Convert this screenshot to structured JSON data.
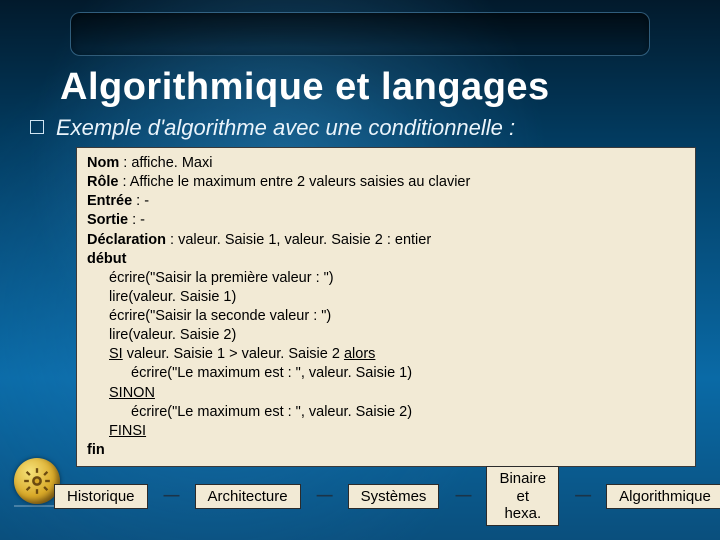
{
  "title": "Algorithmique et langages",
  "subtitle": "Exemple d'algorithme avec une conditionnelle :",
  "algo": {
    "nom_label": "Nom",
    "nom_value": " : affiche. Maxi",
    "role_label": "Rôle",
    "role_value": " : Affiche le maximum entre 2 valeurs saisies au clavier",
    "entree_label": "Entrée",
    "entree_value": " : -",
    "sortie_label": "Sortie",
    "sortie_value": " : -",
    "decl_label": "Déclaration",
    "decl_value": " : valeur. Saisie 1, valeur. Saisie 2 : entier",
    "debut": "début",
    "l1": "écrire(\"Saisir la première valeur : \")",
    "l2": "lire(valeur. Saisie 1)",
    "l3": "écrire(\"Saisir la seconde valeur : \")",
    "l4": "lire(valeur. Saisie 2)",
    "si": "SI",
    "si_cond": " valeur. Saisie 1 > valeur. Saisie 2 ",
    "alors": "alors",
    "l5": "écrire(\"Le maximum est : \", valeur. Saisie 1)",
    "sinon": "SINON",
    "l6": "écrire(\"Le maximum est : \", valeur. Saisie 2)",
    "finsi": "FINSI",
    "fin": "fin"
  },
  "nav": {
    "historique": "Historique",
    "architecture": "Architecture",
    "systemes": "Systèmes",
    "binaire": "Binaire et hexa.",
    "algo": "Algorithmique"
  }
}
